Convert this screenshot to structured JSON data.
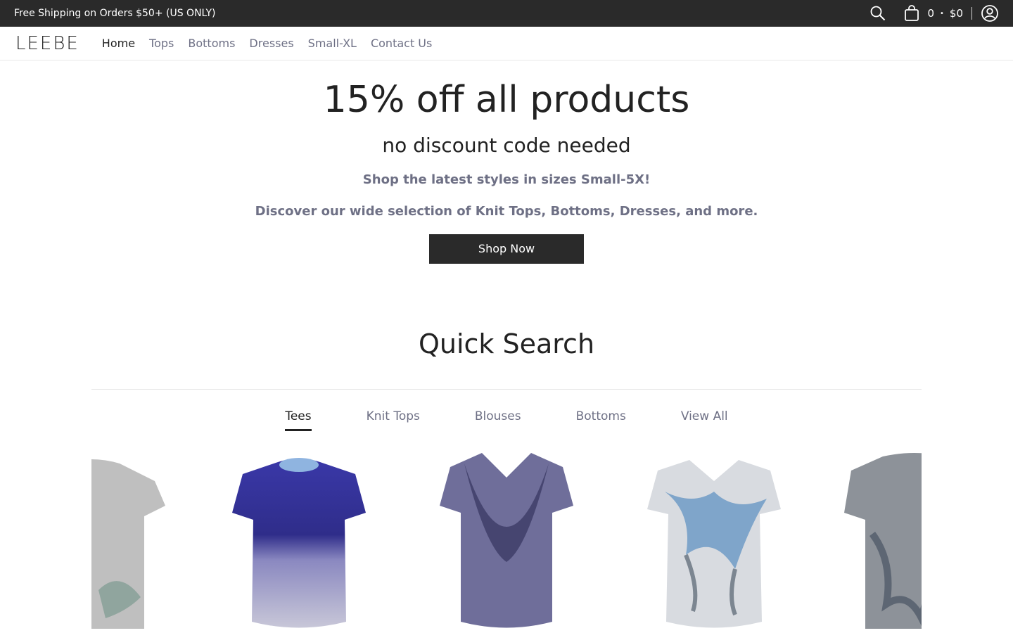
{
  "topbar": {
    "shipping_text": "Free Shipping on Orders $50+ (US ONLY)",
    "cart_count": "0",
    "cart_total": "$0"
  },
  "nav": {
    "logo": "LEEBE",
    "links": [
      "Home",
      "Tops",
      "Bottoms",
      "Dresses",
      "Small-XL",
      "Contact Us"
    ]
  },
  "hero": {
    "title": "15% off all products",
    "subtitle": "no discount code needed",
    "line1": "Shop the latest styles in sizes Small-5X!",
    "line2": "Discover our wide selection of Knit Tops, Bottoms, Dresses, and more.",
    "button": "Shop Now"
  },
  "quick_search": {
    "title": "Quick Search",
    "tabs": [
      "Tees",
      "Knit Tops",
      "Blouses",
      "Bottoms",
      "View All"
    ],
    "active_tab": "Tees"
  },
  "colors": {
    "dark": "#2a2a2a",
    "muted": "#6e7085"
  },
  "icons": [
    "search-icon",
    "cart-icon",
    "account-icon"
  ]
}
